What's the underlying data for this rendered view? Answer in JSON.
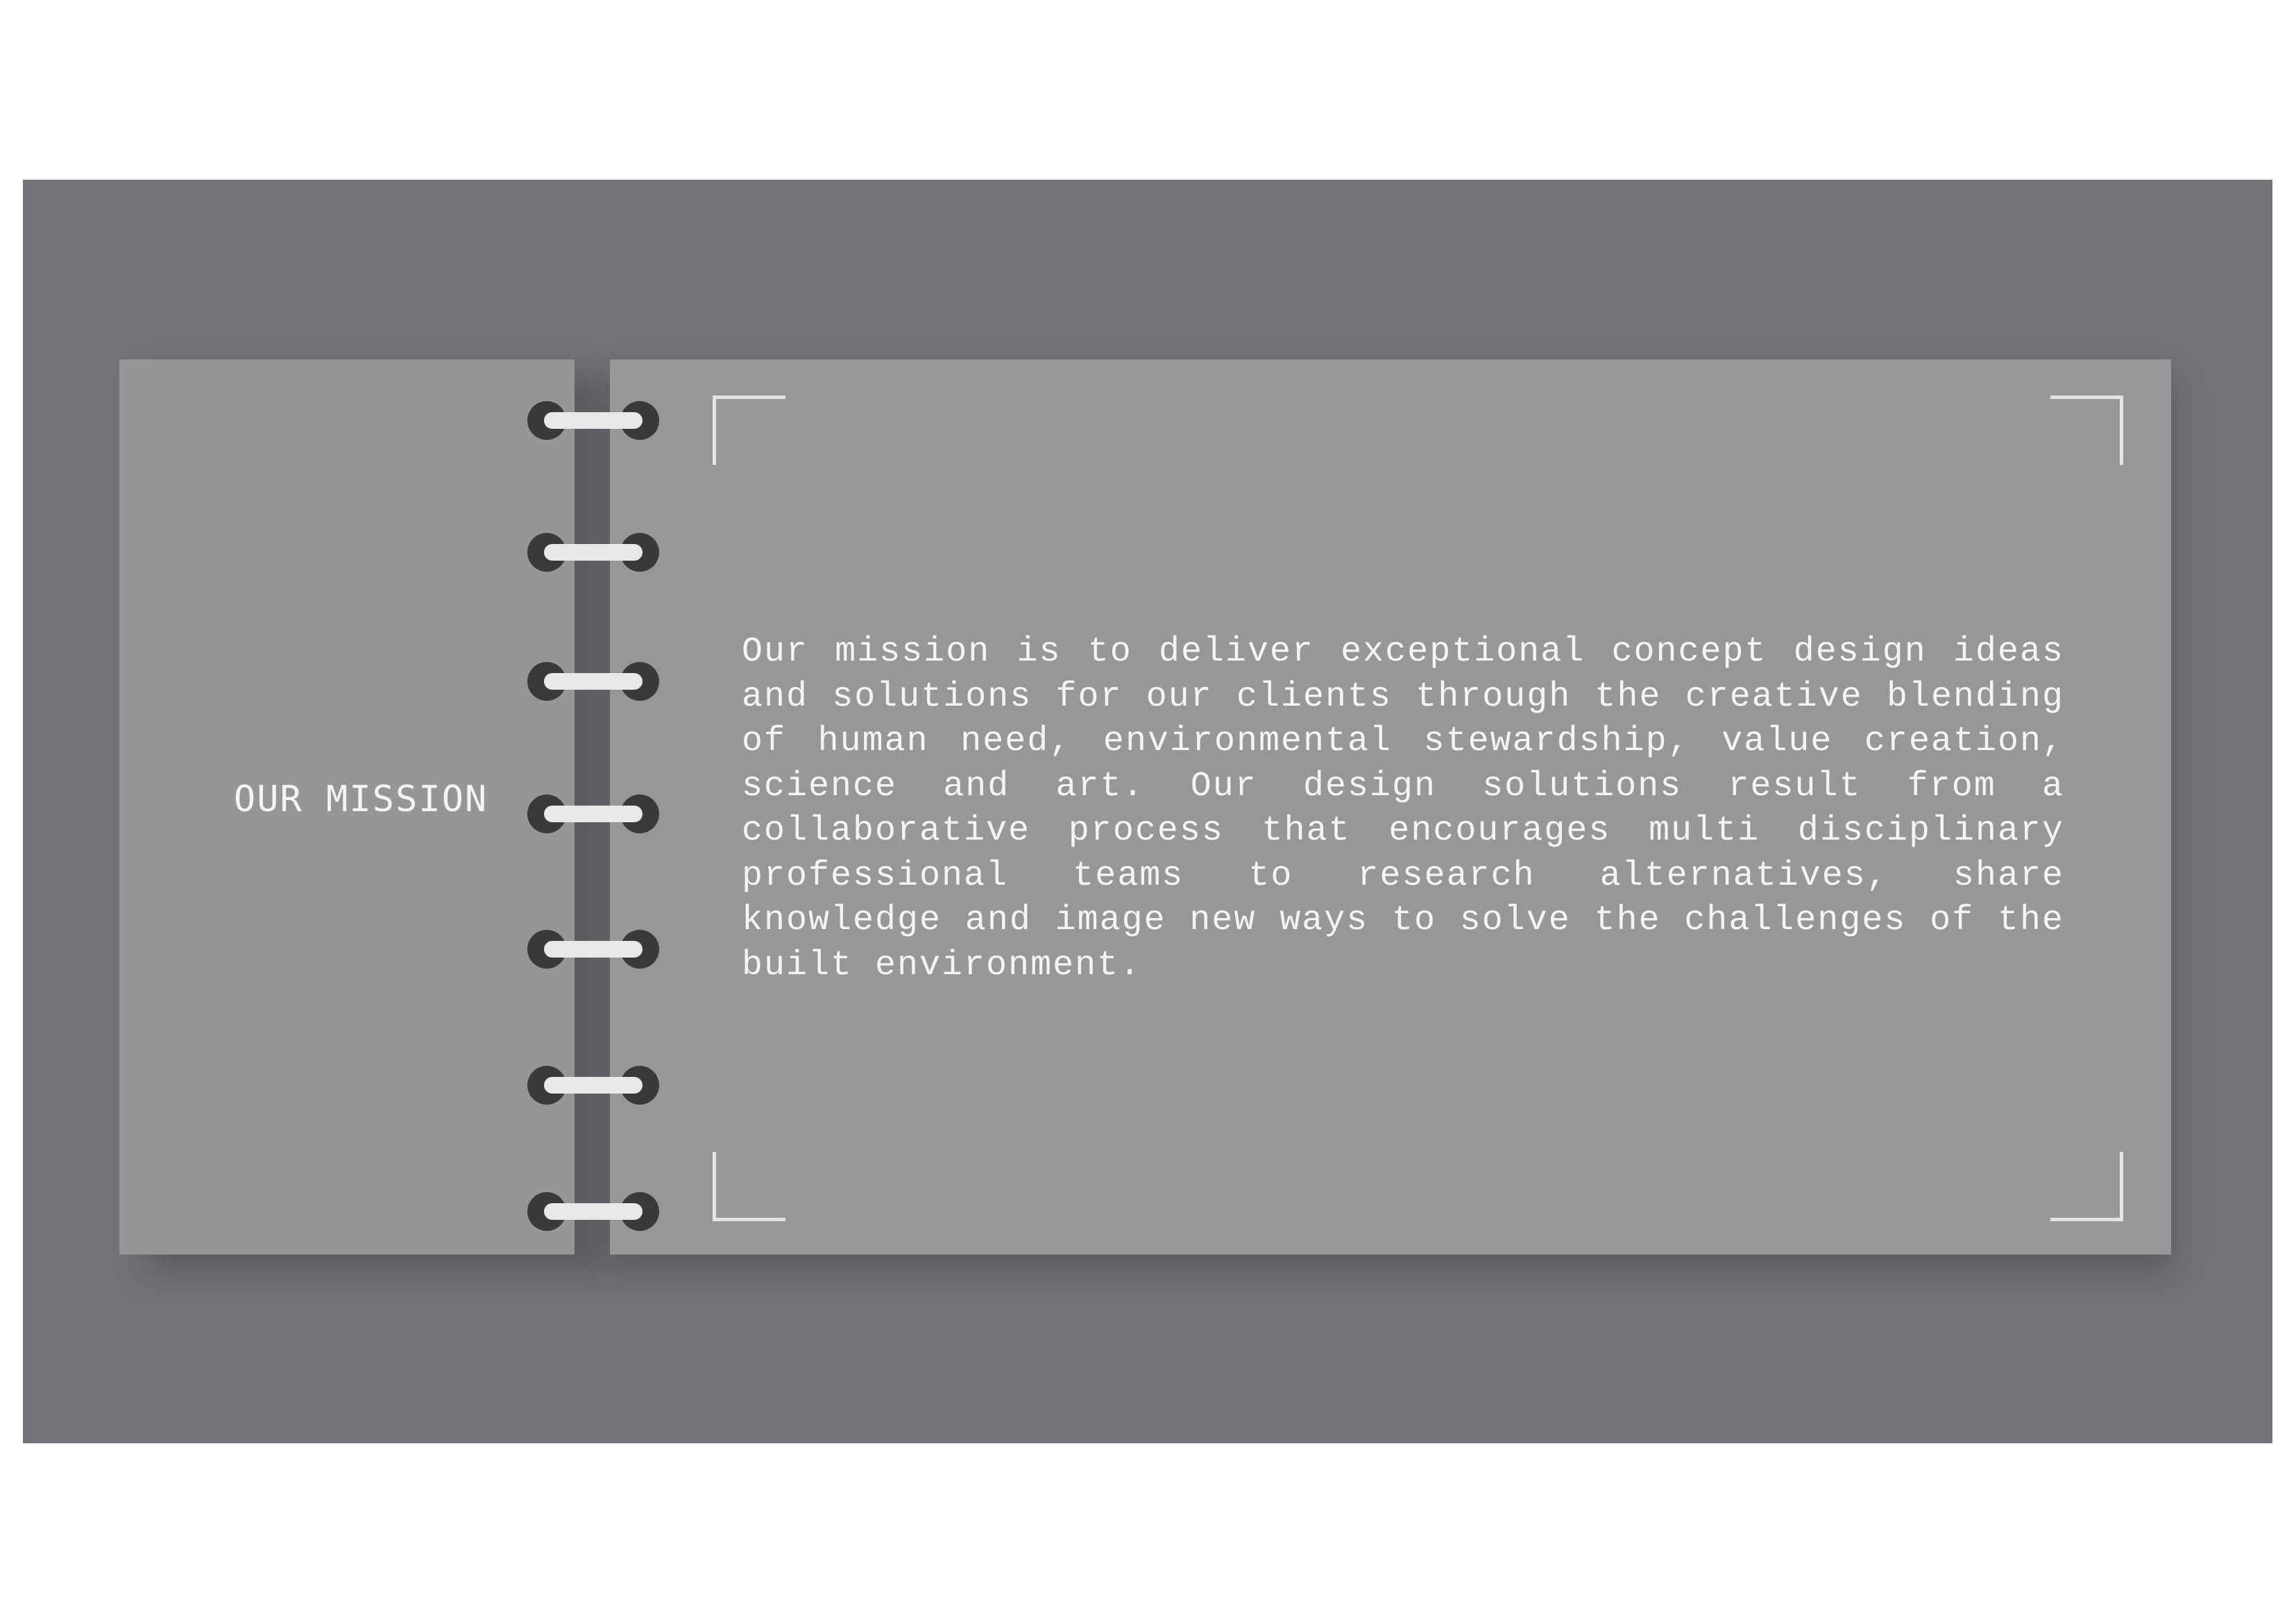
{
  "section": {
    "title": "OUR MISSION"
  },
  "mission": {
    "body": "Our mission is to deliver exceptional concept design ideas and solutions for our clients through the creative blending of human need, environmental stewardship, value creation, science and art. Our design solutions result from a collaborative process that encourages multi disciplinary professional teams to research alternatives, share knowledge and image new ways to solve the challenges of the built environment."
  },
  "colors": {
    "background": "#ffffff",
    "backdrop": "#737276",
    "page": "#979799",
    "text": "#f4f4f4",
    "ring_hole": "#3a393b",
    "ring_bar": "#e8e8e9"
  },
  "binding": {
    "ring_count": 7
  }
}
